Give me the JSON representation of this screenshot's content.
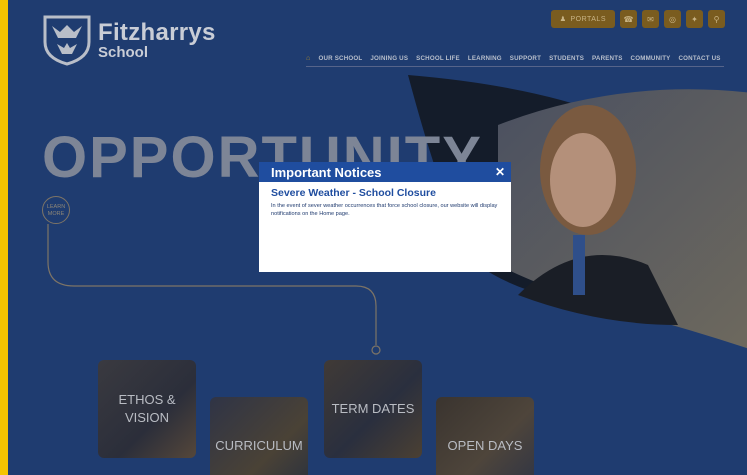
{
  "site": {
    "name": "Fitzharrys",
    "sub": "School"
  },
  "topbar": {
    "portals_label": "PORTALS",
    "icons": [
      "phone-icon",
      "email-icon",
      "instagram-icon",
      "twitter-icon",
      "search-icon"
    ]
  },
  "nav": {
    "items": [
      "OUR SCHOOL",
      "JOINING US",
      "SCHOOL LIFE",
      "LEARNING",
      "SUPPORT",
      "STUDENTS",
      "PARENTS",
      "COMMUNITY",
      "CONTACT US"
    ]
  },
  "hero": {
    "word": "OPPORTUNITY",
    "learn_more": "LEARN MORE"
  },
  "tiles": [
    "ETHOS & VISION",
    "CURRICULUM",
    "TERM DATES",
    "OPEN DAYS"
  ],
  "modal": {
    "title": "Important Notices",
    "close": "✕",
    "notice_title": "Severe Weather - School Closure",
    "notice_text": "In the event of sever weather occurrences that force school closure, our website will display notifications on the Home page."
  },
  "colors": {
    "background": "#1f3c70",
    "modal_header": "#1f4d9f",
    "border": "#f5c400"
  }
}
